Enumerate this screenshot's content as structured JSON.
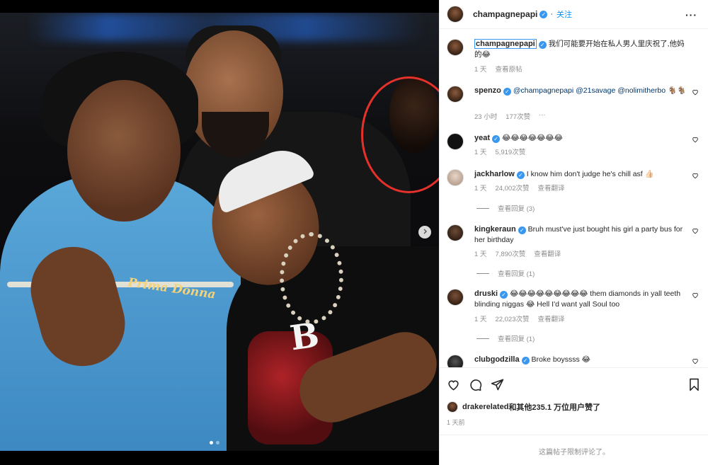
{
  "post": {
    "author": "champagnepapi",
    "follow_label": "关注",
    "more_label": "···",
    "caption_text": "我们可能要开始在私人男人里庆祝了,他妈的😂",
    "caption_time": "1 天",
    "caption_translate": "查看原帖",
    "image_circle_color": "#e5312b",
    "carousel_total": 2,
    "carousel_active": 1,
    "shirt_logo": "Prima Donna"
  },
  "comments": [
    {
      "user": "spenzo",
      "verified": true,
      "text": "@champagnepapi @21savage @nolimitherbo 🐐🐐",
      "time": "23 小时",
      "likes": "177次赞",
      "extra": "···"
    },
    {
      "user": "yeat",
      "verified": true,
      "text": "😂😂😂😂😂😂😂",
      "time": "1 天",
      "likes": "5,919次赞",
      "extra": ""
    },
    {
      "user": "jackharlow",
      "verified": true,
      "text": "I know him don't judge he's chill asf 👍🏻",
      "time": "1 天",
      "likes": "24,002次赞",
      "extra": "查看翻译",
      "replies": "查看回复 (3)"
    },
    {
      "user": "kingkeraun",
      "verified": true,
      "text": "Bruh must've just bought his girl a party bus for her birthday",
      "time": "1 天",
      "likes": "7,890次赞",
      "extra": "查看翻译",
      "replies": "查看回复 (1)"
    },
    {
      "user": "druski",
      "verified": true,
      "text": "😂😂😂😂😂😂😂😂😂 them diamonds in yall teeth blinding niggas 😂 Hell I'd want yall Soul too",
      "time": "1 天",
      "likes": "22,023次赞",
      "extra": "查看翻译",
      "replies": "查看回复 (1)"
    },
    {
      "user": "clubgodzilla",
      "verified": true,
      "text": "Broke boyssss 😂",
      "time": "",
      "likes": "",
      "extra": ""
    }
  ],
  "footer": {
    "liked_by_user": "drakerelated",
    "liked_by_rest": "和其他235.1 万位用户赞了",
    "date": "1 天前",
    "comments_closed": "这篇帖子限制评论了。"
  },
  "icons": {
    "like": "heart-icon",
    "comment": "comment-icon",
    "share": "paper-plane-icon",
    "save": "bookmark-icon",
    "verified": "verified-badge-icon",
    "next": "chevron-right-icon"
  },
  "colors": {
    "link_blue": "#0095f6",
    "verified_blue": "#3897f0",
    "muted": "#8e8e8e"
  }
}
